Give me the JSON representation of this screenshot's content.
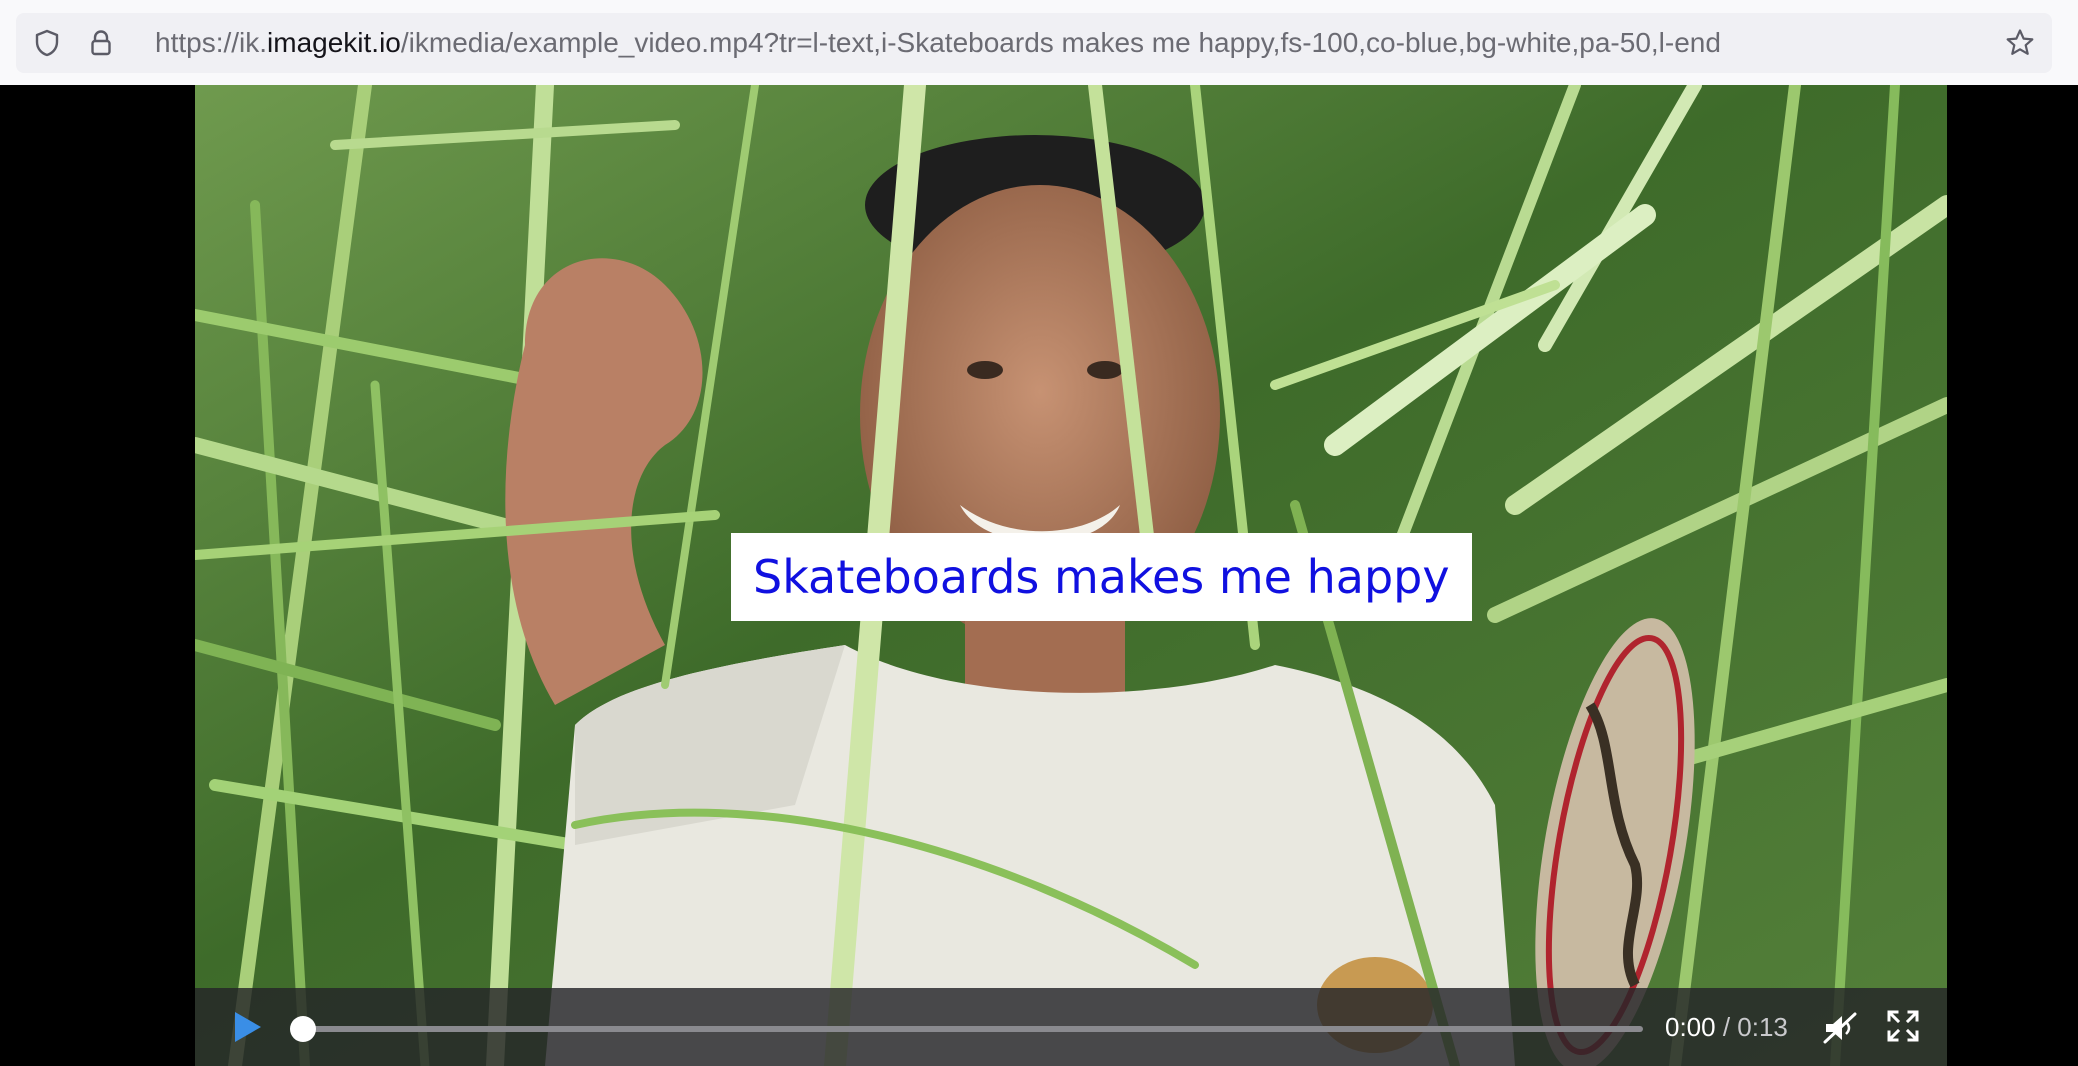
{
  "browser": {
    "url_prefix": "https://ik.",
    "url_domain": "imagekit.io",
    "url_path": "/ikmedia/example_video.mp4?tr=l-text,i-Skateboards makes me happy,fs-100,co-blue,bg-white,pa-50,l-end",
    "icons": [
      "shield-icon",
      "lock-icon",
      "star-icon"
    ]
  },
  "video": {
    "overlay_text": "Skateboards makes me happy",
    "overlay_text_color": "#1010e0",
    "overlay_bg_color": "#ffffff",
    "current_time": "0:00",
    "separator": " / ",
    "duration": "0:13",
    "progress": 0,
    "accent_color": "#3a8ee6",
    "icons": [
      "play-icon",
      "muted-icon",
      "fullscreen-icon"
    ]
  }
}
